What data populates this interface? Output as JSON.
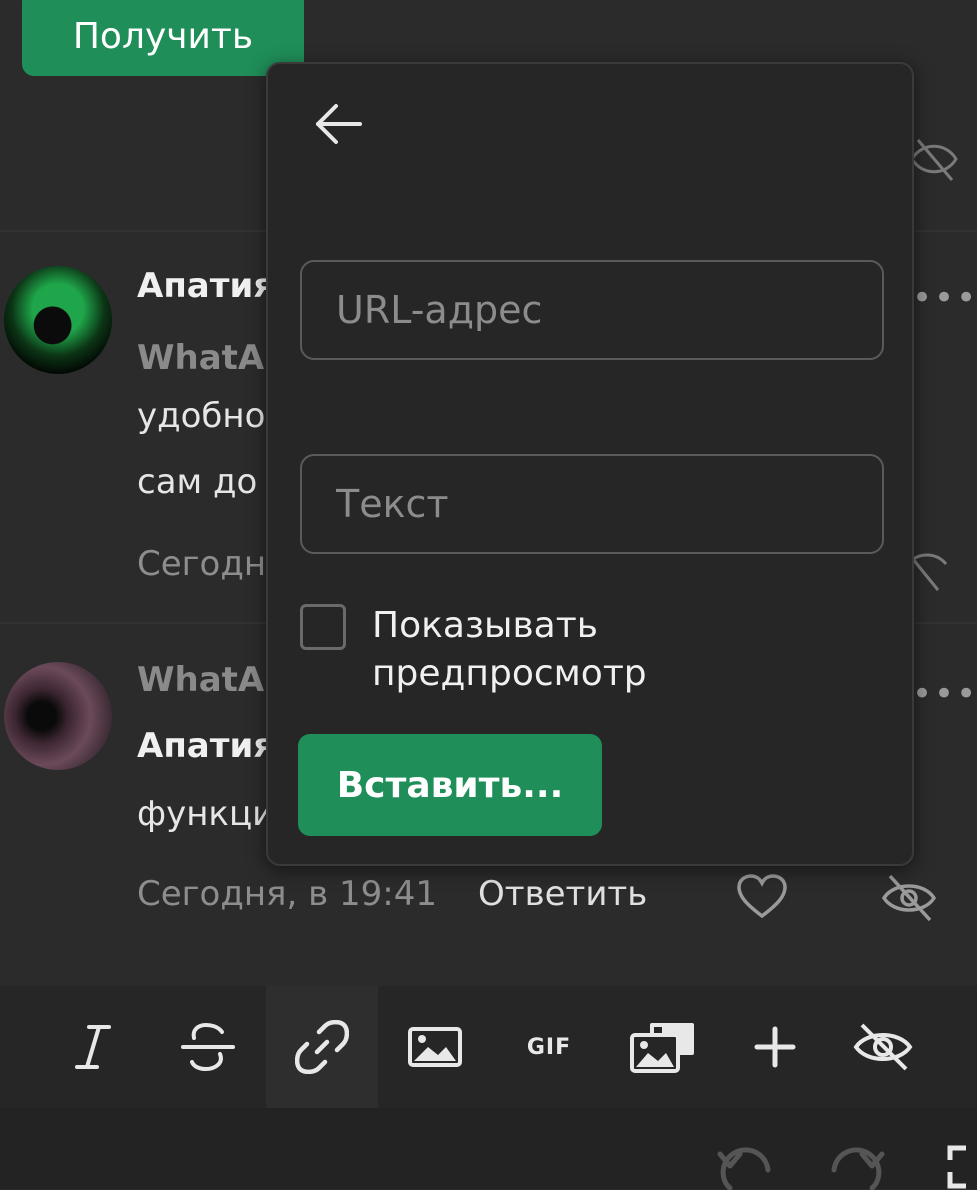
{
  "header": {
    "get_button_label": "Получить"
  },
  "comments": [
    {
      "author": "Апатия",
      "lines": [
        "WhatA",
        "удобно",
        "сам до"
      ],
      "time_partial": "Сегодн"
    },
    {
      "author_top": "WhatA",
      "author": "Апатия",
      "line": "функци",
      "time": "Сегодня, в 19:41",
      "reply": "Ответить"
    }
  ],
  "popup": {
    "url_placeholder": "URL-адрес",
    "text_placeholder": "Текст",
    "checkbox_label": "Показывать предпросмотр",
    "insert_button": "Вставить..."
  },
  "toolbar": {
    "gif_label": "GIF",
    "icons": [
      "italic-icon",
      "strikethrough-icon",
      "link-icon",
      "image-icon",
      "gif-icon",
      "gallery-icon",
      "plus-icon",
      "eye-off-icon"
    ]
  },
  "colors": {
    "accent": "#1f8e58",
    "background": "#2b2b2b"
  }
}
